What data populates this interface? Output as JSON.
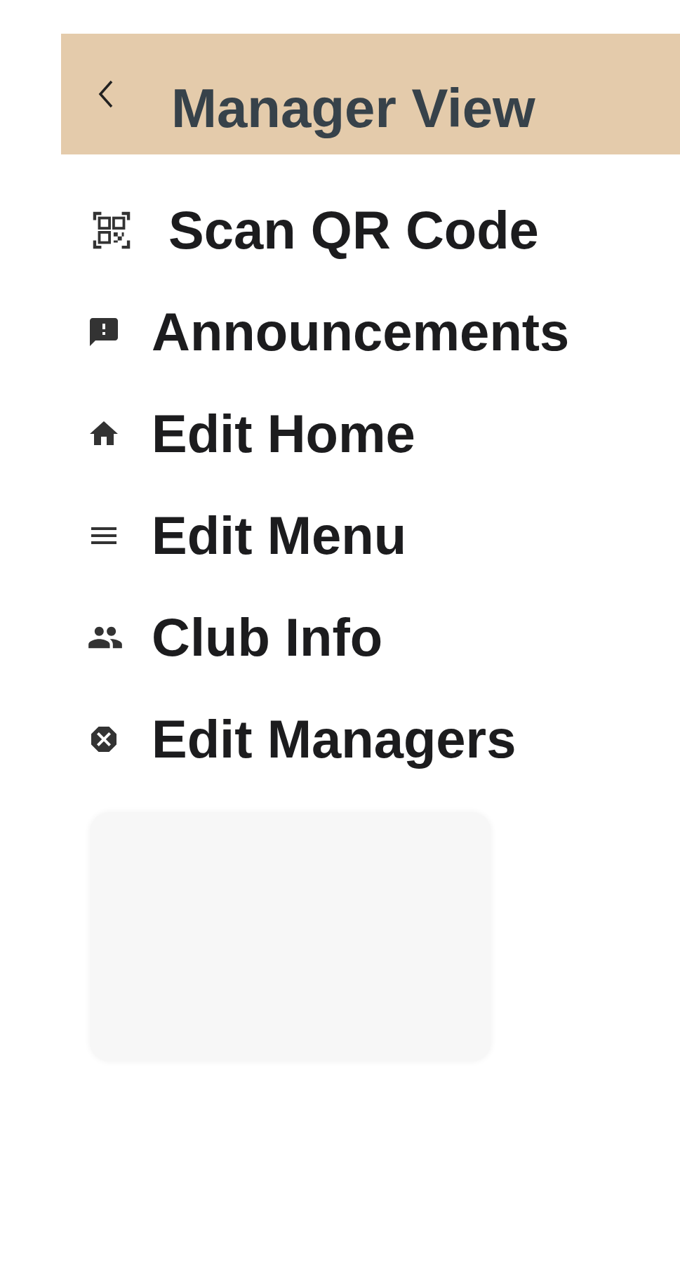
{
  "header": {
    "title": "Manager View"
  },
  "menu_items": [
    {
      "label": "Scan QR Code"
    },
    {
      "label": "Announcements"
    },
    {
      "label": "Edit Home"
    },
    {
      "label": "Edit Menu"
    },
    {
      "label": "Club Info"
    },
    {
      "label": "Edit Managers"
    }
  ]
}
